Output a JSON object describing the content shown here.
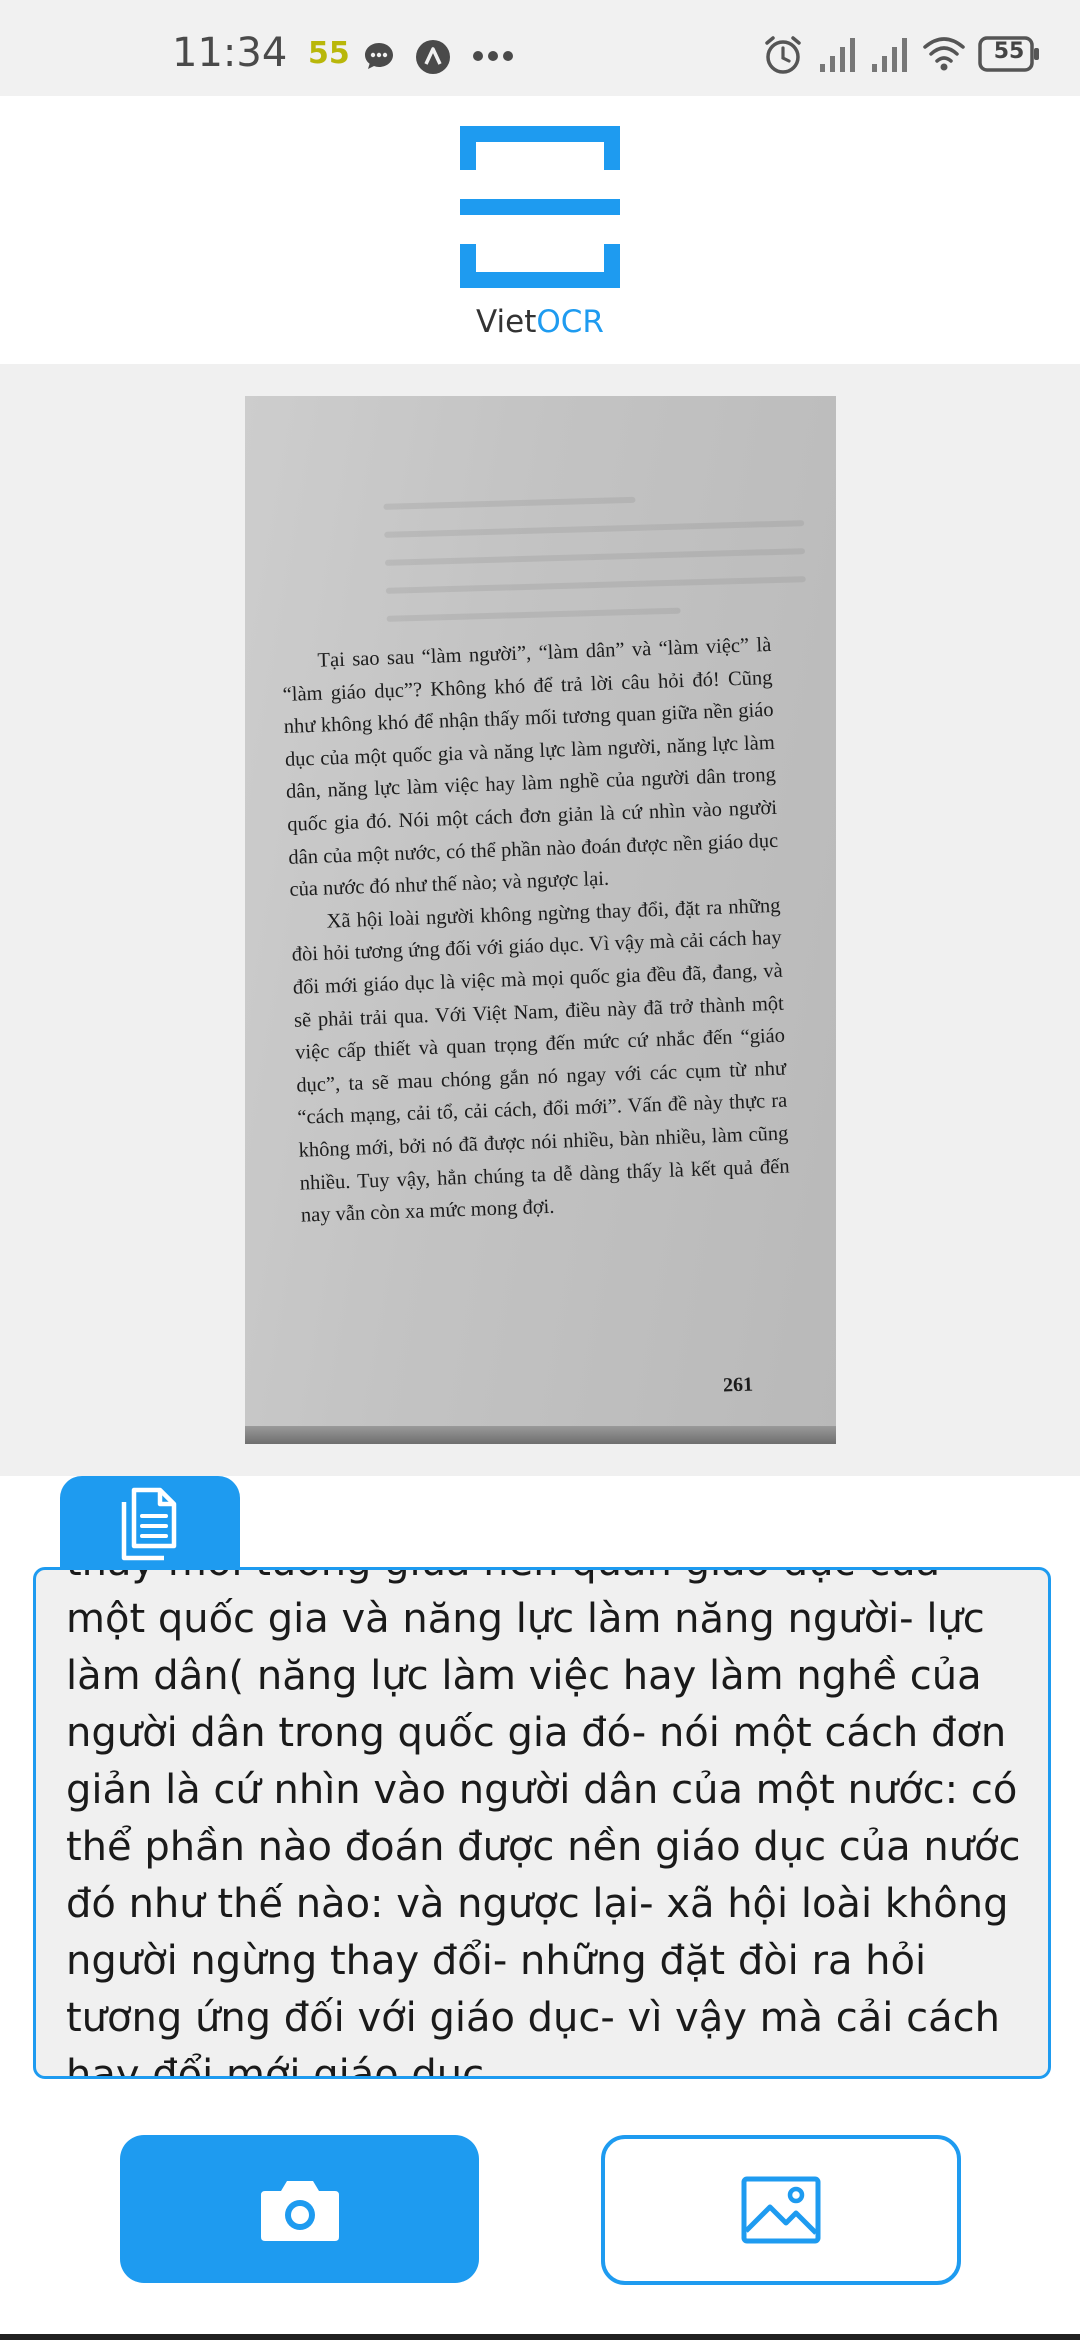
{
  "status_bar": {
    "time": "11:34",
    "notification_badge": "55",
    "battery_level": "55",
    "icons": [
      "chat-bubble-icon",
      "a-circle-icon",
      "more-dots-icon",
      "alarm-icon",
      "signal-icon",
      "signal-icon",
      "wifi-icon",
      "battery-icon"
    ]
  },
  "header": {
    "logo_icon": "scan-frame-icon",
    "app_name_prefix": "Viet",
    "app_name_suffix": "OCR"
  },
  "preview": {
    "paragraphs": [
      "Tại sao sau “làm người”, “làm dân” và “làm việc” là “làm giáo dục”? Không khó để trả lời câu hỏi đó! Cũng như không khó để nhận thấy mối tương quan giữa nền giáo dục của một quốc gia và năng lực làm người, năng lực làm dân, năng lực làm việc hay làm nghề của người dân trong quốc gia đó. Nói một cách đơn giản là cứ nhìn vào người dân của một nước, có thể phần nào đoán được nền giáo dục của nước đó như thế nào; và ngược lại.",
      "Xã hội loài người không ngừng thay đổi, đặt ra những đòi hỏi tương ứng đối với giáo dục. Vì vậy mà cải cách hay đổi mới giáo dục là việc mà mọi quốc gia đều đã, đang, và sẽ phải trải qua. Với Việt Nam, điều này đã trở thành một việc cấp thiết và quan trọng đến mức cứ nhắc đến “giáo dục”, ta sẽ mau chóng gắn nó ngay với các cụm từ như “cách mạng, cải tổ, cải cách, đổi mới”. Vấn đề này thực ra không mới, bởi nó đã được nói nhiều, bàn nhiều, làm cũng nhiều. Tuy vậy, hẳn chúng ta dễ dàng thấy là kết quả đến nay vẫn còn xa mức mong đợi."
    ],
    "page_number": "261"
  },
  "result": {
    "tab_icon": "document-icon",
    "text": "thấy mối tương giữa nền quan giáo dục của một quốc gia và năng lực làm năng người- lực làm dân( năng lực làm việc hay làm nghề của người dân trong quốc gia đó- nói một cách đơn giản là cứ nhìn vào người dân của một nước: có thể phần nào đoán được nền giáo dục của nước đó như thế nào: và ngược lại- xã hội loài không người ngừng thay đổi- những đặt đòi ra hỏi tương ứng đối với giáo dục- vì vậy mà cải cách hay đổi mới giáo dục"
  },
  "actions": {
    "camera_icon": "camera-icon",
    "gallery_icon": "image-icon"
  },
  "colors": {
    "accent": "#1e9bf0",
    "status_bar_bg": "#f1f1f1",
    "preview_bg": "#f0f0f0"
  }
}
